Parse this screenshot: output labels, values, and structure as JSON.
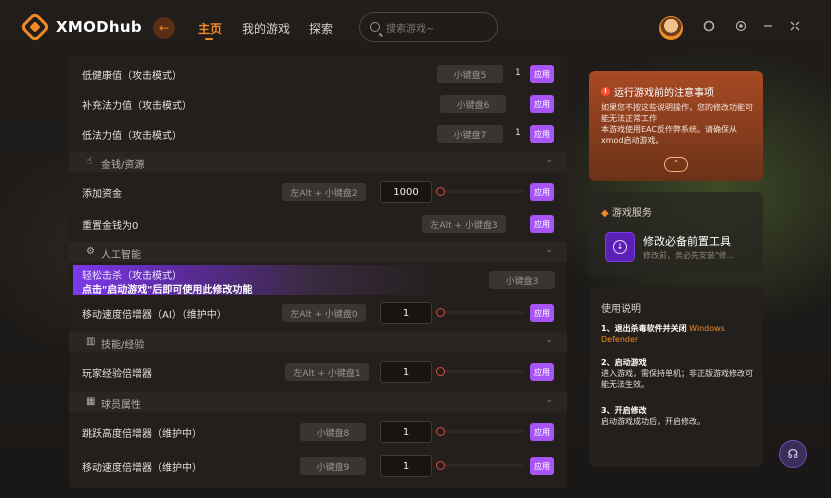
{
  "app": {
    "name": "XMODhub"
  },
  "nav": {
    "back": "←",
    "home": "主页",
    "my_games": "我的游戏",
    "explore": "探索"
  },
  "search": {
    "placeholder": "搜索游戏~"
  },
  "window": {
    "icons": [
      "globe-icon",
      "settings-icon",
      "minimize-icon",
      "close-icon"
    ]
  },
  "colors": {
    "accent": "#f08a24",
    "apply": "#a855f7",
    "highlight": "#7c3aed"
  },
  "rows": [
    {
      "label": "低健康值（攻击模式）",
      "key": "小键盘5",
      "count": "1",
      "apply": "应用"
    },
    {
      "label": "补充法力值（攻击模式）",
      "key": "小键盘6",
      "apply": "应用"
    },
    {
      "label": "低法力值（攻击模式）",
      "key": "小键盘7",
      "count": "1",
      "apply": "应用"
    },
    {
      "label": "添加资金",
      "key": "左Alt + 小键盘2",
      "value": "1000",
      "apply": "应用"
    },
    {
      "label": "重置金钱为0",
      "key": "左Alt + 小键盘3",
      "apply": "应用"
    },
    {
      "label": "轻松击杀（攻击模式）",
      "key": "小键盘3"
    },
    {
      "label": "移动速度倍增器（AI）（维护中）",
      "key": "左Alt + 小键盘0",
      "value": "1",
      "apply": "应用"
    },
    {
      "label": "玩家经验倍增器",
      "key": "左Alt + 小键盘1",
      "value": "1",
      "apply": "应用"
    },
    {
      "label": "跳跃高度倍增器（维护中）",
      "key": "小键盘8",
      "value": "1",
      "apply": "应用"
    },
    {
      "label": "移动速度倍增器（维护中）",
      "key": "小键盘9",
      "value": "1",
      "apply": "应用"
    }
  ],
  "sections": [
    {
      "label": "金钱/资源",
      "chevron": "⌄"
    },
    {
      "label": "人工智能",
      "chevron": "⌄"
    },
    {
      "label": "技能/经验",
      "chevron": "⌄"
    },
    {
      "label": "球员属性",
      "chevron": "⌄"
    }
  ],
  "highlight_note": "点击\"启动游戏\"后即可使用此修改功能",
  "notice": {
    "title": "运行游戏前的注意事项",
    "line1": "如果您不按这些说明操作，您的修改功能可能无法正常工作",
    "line2": "本游戏使用EAC反作弊系统。请确保从xmod启动游戏。",
    "toggle": "⌃"
  },
  "service": {
    "title": "游戏服务",
    "name": "修改必备前置工具",
    "desc": "修改前，务必先安装\"修..."
  },
  "help": {
    "title": "使用说明",
    "s1_title": "1、退出杀毒软件并关闭",
    "s1_hl": "Windows Defender",
    "s2_title": "2、启动游戏",
    "s2_body": "进入游戏，需保持单机；非正版游戏修改可能无法生效。",
    "s3_title": "3、开启修改",
    "s3_body": "启动游戏成功后，开启修改。"
  }
}
